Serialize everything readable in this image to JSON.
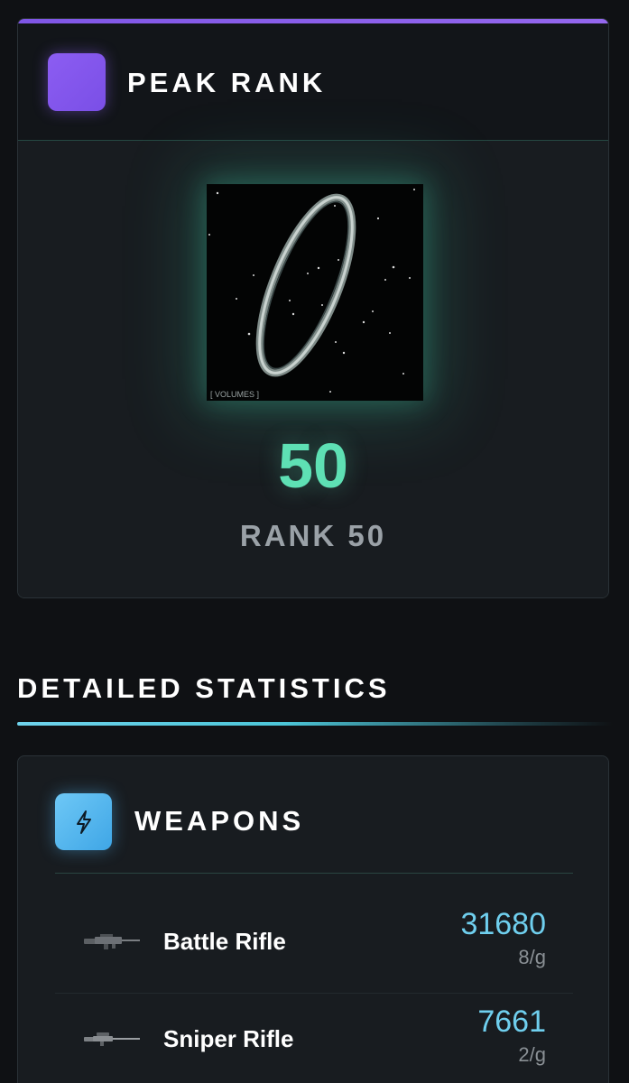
{
  "peak_rank": {
    "title": "PEAK RANK",
    "rank_number": "50",
    "rank_label": "RANK 50",
    "art_caption": "[ VOLUMES ]",
    "accent_color": "#8c5df2",
    "rank_color": "#5ee0b4"
  },
  "detailed_statistics": {
    "title": "DETAILED STATISTICS"
  },
  "weapons": {
    "title": "WEAPONS",
    "icon": "lightning-bolt-icon",
    "accent_color": "#4fafeb",
    "items": [
      {
        "name": "Battle Rifle",
        "value": "31680",
        "rate": "8/g",
        "icon": "battle-rifle-icon"
      },
      {
        "name": "Sniper Rifle",
        "value": "7661",
        "rate": "2/g",
        "icon": "sniper-rifle-icon"
      }
    ]
  }
}
